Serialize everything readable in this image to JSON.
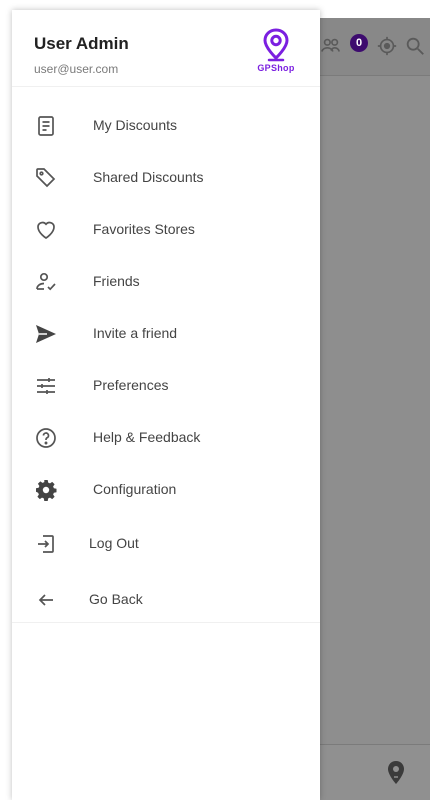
{
  "drawer": {
    "user_name": "User Admin",
    "user_email": "user@user.com",
    "logo_text": "GPShop",
    "menu": [
      {
        "label": "My Discounts",
        "icon": "document-list-icon"
      },
      {
        "label": "Shared Discounts",
        "icon": "tag-icon"
      },
      {
        "label": "Favorites Stores",
        "icon": "heart-icon"
      },
      {
        "label": "Friends",
        "icon": "person-check-icon"
      },
      {
        "label": "Invite a friend",
        "icon": "send-icon"
      },
      {
        "label": "Preferences",
        "icon": "sliders-icon"
      },
      {
        "label": "Help & Feedback",
        "icon": "help-circle-icon"
      },
      {
        "label": "Configuration",
        "icon": "gear-icon"
      },
      {
        "label": "Log Out",
        "icon": "logout-icon"
      },
      {
        "label": "Go Back",
        "icon": "arrow-left-icon"
      }
    ]
  },
  "background_app": {
    "cart_badge_count": "0"
  },
  "colors": {
    "brand": "#7b1fe0",
    "overlay": "#8e8e8e",
    "badge": "#3d0b6e"
  }
}
